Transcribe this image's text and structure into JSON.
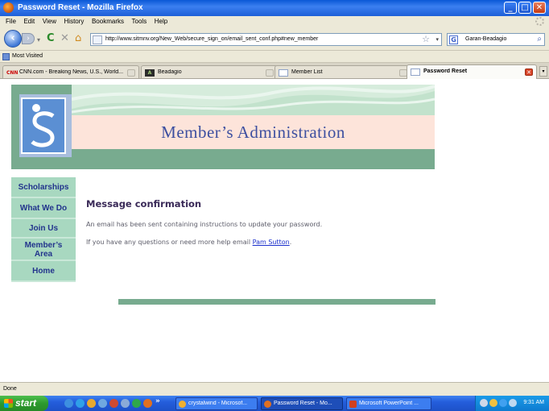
{
  "window": {
    "title": "Password Reset - Mozilla Firefox",
    "minimize": "_",
    "maximize": "□",
    "close": "✕"
  },
  "menu": [
    "File",
    "Edit",
    "View",
    "History",
    "Bookmarks",
    "Tools",
    "Help"
  ],
  "nav": {
    "url": "http://www.sitmnv.org/New_Web/secure_sign_on/email_sent_conf.php#new_member",
    "search_value": "Garan-Beadagio",
    "search_engine_icon": "google-icon"
  },
  "bookmarks_bar": {
    "label": "Most Visited"
  },
  "tabs": [
    {
      "label": "CNN.com - Breaking News, U.S., World...",
      "icon_text": "CNN",
      "icon_color": "#cc0000",
      "active": false
    },
    {
      "label": "Beadagio",
      "icon_text": "A",
      "icon_color": "#2b2b2b",
      "active": false
    },
    {
      "label": "Member List",
      "icon_text": "",
      "icon_color": "#7a93c8",
      "active": false
    },
    {
      "label": "Password Reset",
      "icon_text": "",
      "icon_color": "#7a93c8",
      "active": true
    }
  ],
  "site": {
    "banner_title": "Member’s Administration",
    "sidenav": [
      {
        "label": "Scholarships"
      },
      {
        "label": "What We Do"
      },
      {
        "label": "Join Us"
      },
      {
        "label": "Member’s Area"
      },
      {
        "label": "Home"
      }
    ],
    "message_title": "Message confirmation",
    "message_line1": "An email has been sent containing instructions to update your password.",
    "message_line2_prefix": "If you have any questions or need more help email ",
    "message_link": "Pam Sutton",
    "message_line2_suffix": "."
  },
  "status": "Done",
  "taskbar": {
    "start": "start",
    "more": "»",
    "buttons": [
      {
        "label": "crystalwind - Microsof...",
        "icon_color": "#f0b030",
        "active": false
      },
      {
        "label": "Password Reset - Mo...",
        "icon_color": "#e07020",
        "active": true
      },
      {
        "label": "Microsoft PowerPoint ...",
        "icon_color": "#d04020",
        "active": false
      }
    ],
    "clock": "9:31 AM"
  },
  "colors": {
    "banner_green": "#78ab8f",
    "nav_green": "#a8d8c0",
    "nav_text": "#22338c",
    "banner_title": "#3c4fa0",
    "pink": "#fde4da",
    "link": "#1a2fcc"
  }
}
